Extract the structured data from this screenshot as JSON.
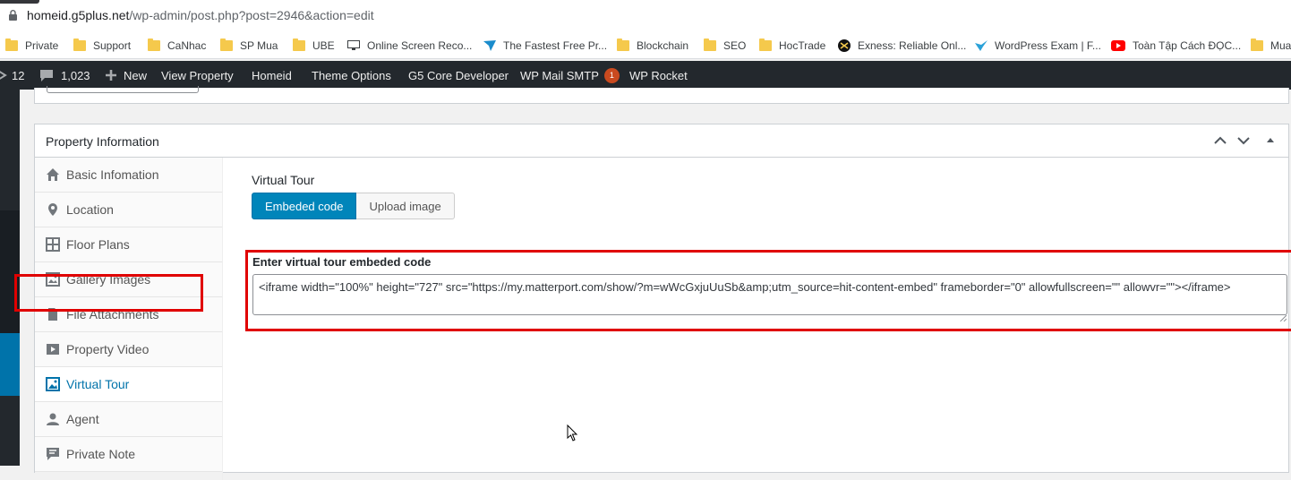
{
  "browser": {
    "url_host": "homeid.g5plus.net",
    "url_path": "/wp-admin/post.php?post=2946&action=edit",
    "bookmarks": [
      {
        "label": "Private",
        "icon": "folder-icon"
      },
      {
        "label": "Support",
        "icon": "folder-icon"
      },
      {
        "label": "CaNhac",
        "icon": "folder-icon"
      },
      {
        "label": "SP Mua",
        "icon": "folder-icon"
      },
      {
        "label": "UBE",
        "icon": "folder-icon"
      },
      {
        "label": "Online Screen Reco...",
        "icon": "monitor-icon"
      },
      {
        "label": "The Fastest Free Pr...",
        "icon": "paper-plane-icon"
      },
      {
        "label": "Blockchain",
        "icon": "folder-icon"
      },
      {
        "label": "SEO",
        "icon": "folder-icon"
      },
      {
        "label": "HocTrade",
        "icon": "folder-icon"
      },
      {
        "label": "Exness: Reliable Onl...",
        "icon": "exness-icon"
      },
      {
        "label": "WordPress Exam | F...",
        "icon": "bird-icon"
      },
      {
        "label": "Toàn Tập Cách ĐỌC...",
        "icon": "youtube-icon"
      },
      {
        "label": "Mua",
        "icon": "folder-icon"
      }
    ]
  },
  "adminbar": {
    "updates_count": "12",
    "comments_count": "1,023",
    "new_label": "New",
    "view_property": "View Property",
    "site_name": "Homeid",
    "theme_options": "Theme Options",
    "core_dev": "G5 Core Developer",
    "mail_smtp": "WP Mail SMTP",
    "mail_badge": "1",
    "rocket": "WP Rocket"
  },
  "metabox": {
    "title": "Property Information",
    "tabs": [
      {
        "label": "Basic Infomation",
        "icon": "home-icon"
      },
      {
        "label": "Location",
        "icon": "map-pin-icon"
      },
      {
        "label": "Floor Plans",
        "icon": "grid-icon"
      },
      {
        "label": "Gallery Images",
        "icon": "gallery-icon"
      },
      {
        "label": "File Attachments",
        "icon": "file-icon"
      },
      {
        "label": "Property Video",
        "icon": "video-icon"
      },
      {
        "label": "Virtual Tour",
        "icon": "image-icon"
      },
      {
        "label": "Agent",
        "icon": "user-icon"
      },
      {
        "label": "Private Note",
        "icon": "note-icon"
      }
    ],
    "active_tab": "Virtual Tour",
    "panel": {
      "section_label": "Virtual Tour",
      "mode_embed": "Embeded code",
      "mode_upload": "Upload image",
      "embed_label": "Enter virtual tour embeded code",
      "embed_value": "<iframe width=\"100%\" height=\"727\" src=\"https://my.matterport.com/show/?m=wWcGxjuUuSb&amp;utm_source=hit-content-embed\" frameborder=\"0\" allowfullscreen=\"\" allowvr=\"\"></iframe>"
    }
  },
  "colors": {
    "adminbar_bg": "#23282d",
    "primary_blue": "#0085ba",
    "highlight_red": "#e00000",
    "badge_orange": "#ca4a1f"
  }
}
